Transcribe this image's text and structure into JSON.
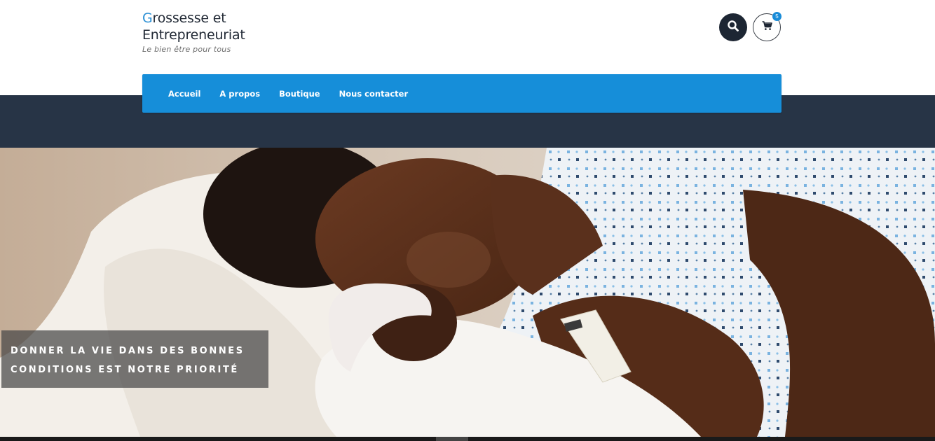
{
  "site": {
    "title_first_letter": "G",
    "title_rest_line1": "rossesse et",
    "title_line2": "Entrepreneuriat",
    "tagline": "Le bien être pour tous"
  },
  "header": {
    "search_icon": "search-icon",
    "cart_icon": "cart-icon",
    "cart_count": "5"
  },
  "nav": {
    "items": [
      {
        "label": "Accueil"
      },
      {
        "label": "A propos"
      },
      {
        "label": "Boutique"
      },
      {
        "label": "Nous contacter"
      }
    ]
  },
  "hero": {
    "caption_line1": "DONNER LA VIE DANS DES BONNES",
    "caption_line2": "CONDITIONS EST NOTRE PRIORITÉ"
  },
  "colors": {
    "accent": "#168ed9",
    "dark_band": "#273446",
    "logo_text": "#222a36"
  }
}
